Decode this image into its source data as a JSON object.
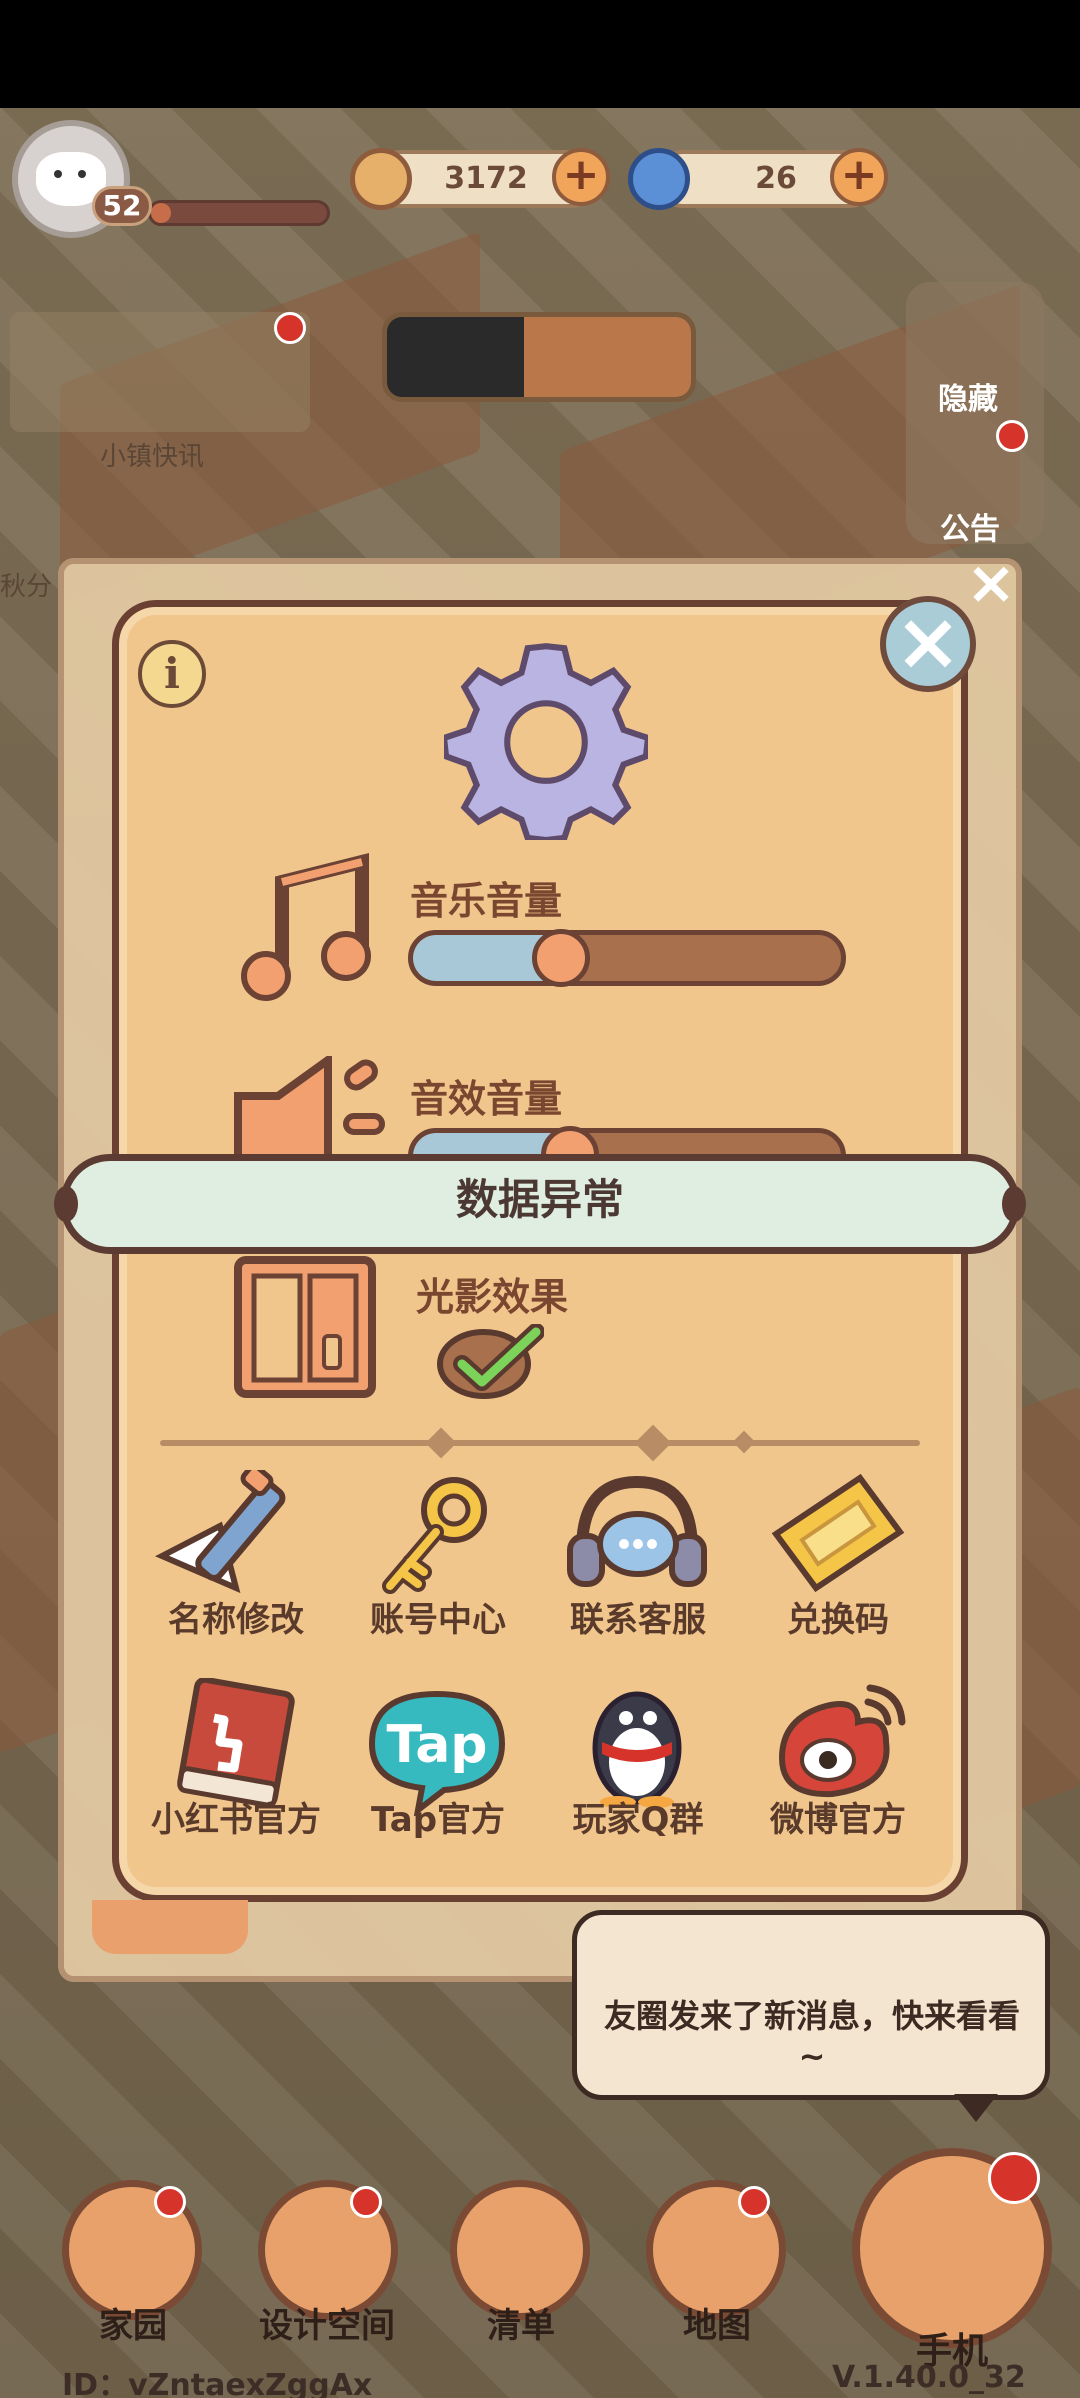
{
  "hud": {
    "level": "52",
    "coins": "3172",
    "gems": "26",
    "plus": "+",
    "news_label": "小镇快讯",
    "autumn_label": "秋分",
    "hide_label": "隐藏",
    "notice_label": "公告"
  },
  "settings": {
    "info": "i",
    "close": "×",
    "music_label": "音乐音量",
    "music_level": 0.35,
    "sfx_label": "音效音量",
    "sfx_level": 0.37,
    "light_label": "光影效果",
    "light_enabled": true
  },
  "banner": {
    "text": "数据异常"
  },
  "grid": [
    {
      "label": "名称修改",
      "icon": "pen-icon"
    },
    {
      "label": "账号中心",
      "icon": "key-icon"
    },
    {
      "label": "联系客服",
      "icon": "headset-icon"
    },
    {
      "label": "兑换码",
      "icon": "ticket-icon"
    },
    {
      "label": "小红书官方",
      "icon": "xiaohongshu-icon"
    },
    {
      "label": "Tap官方",
      "icon": "tap-icon"
    },
    {
      "label": "玩家Q群",
      "icon": "qq-penguin-icon"
    },
    {
      "label": "微博官方",
      "icon": "weibo-icon"
    }
  ],
  "chat": {
    "text": "友圈发来了新消息，快来看看~"
  },
  "nav": {
    "home": "家园",
    "design": "设计空间",
    "list": "清单",
    "map": "地图",
    "phone": "手机"
  },
  "footer": {
    "id": "ID：vZntaexZggAx",
    "version": "V.1.40.0_32"
  },
  "colors": {
    "panel": "#f1c68d",
    "border": "#6a4033",
    "slider_fill": "#a8c8d8",
    "accent_orange": "#f2a070"
  }
}
